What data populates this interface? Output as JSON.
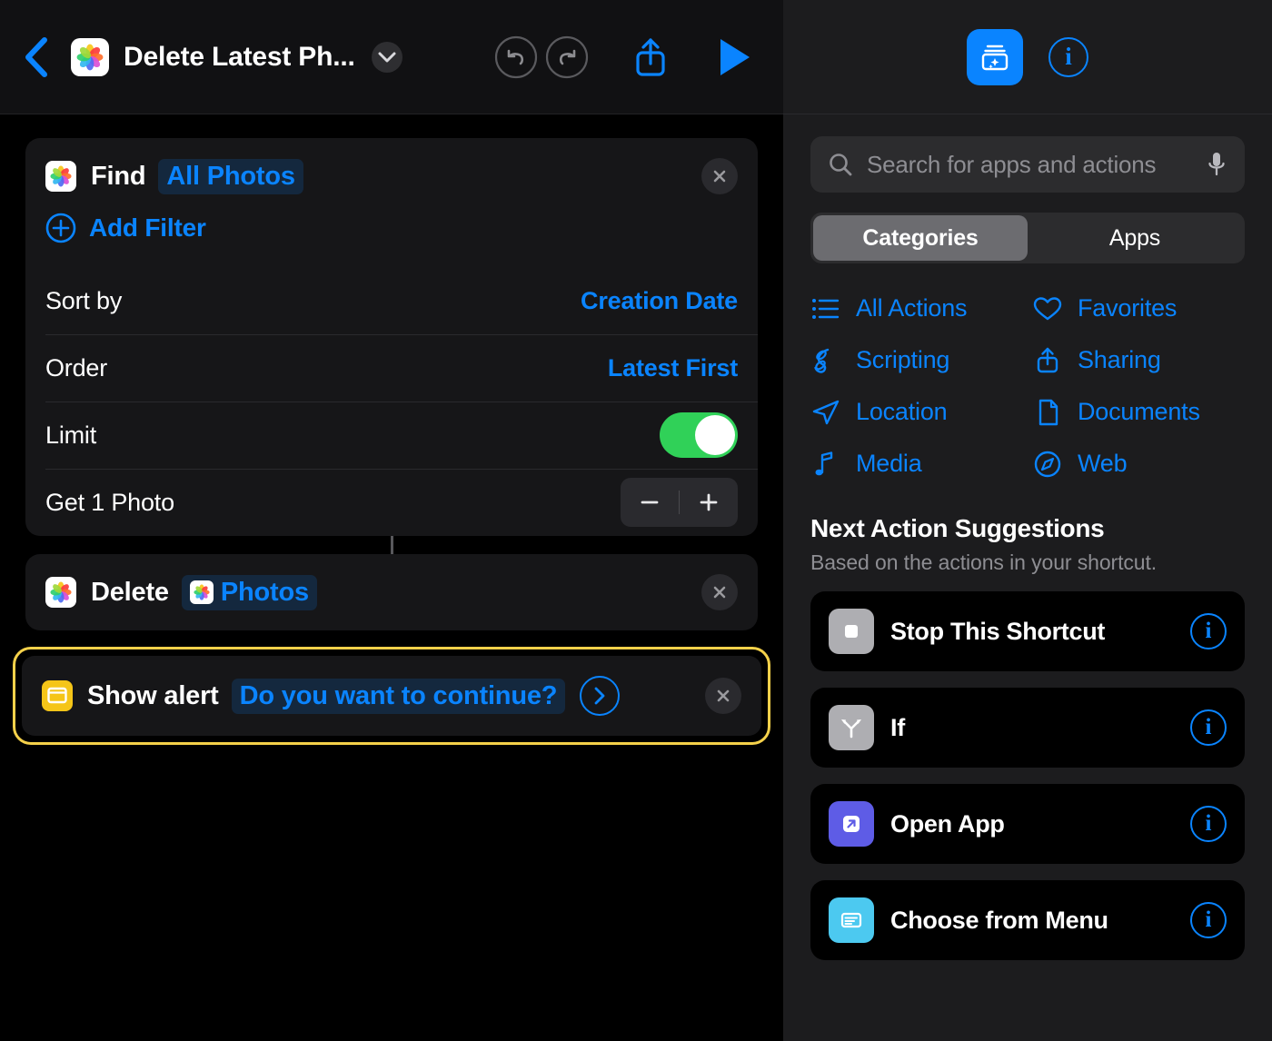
{
  "header": {
    "back_icon": "chevron-left-icon",
    "app_icon": "photos-app-icon",
    "title": "Delete Latest Ph...",
    "title_chevron_icon": "chevron-down-icon",
    "undo_icon": "undo-icon",
    "redo_icon": "redo-icon",
    "share_icon": "share-icon",
    "play_icon": "play-icon",
    "accent_color": "#0a84ff"
  },
  "shortcut": {
    "actions": [
      {
        "id": "find",
        "icon": "photos-app-icon",
        "verb": "Find",
        "token": "All Photos",
        "close_label": "×",
        "add_filter_label": "Add Filter",
        "add_filter_icon": "plus-circle-icon",
        "parameters": [
          {
            "label": "Sort by",
            "value": "Creation Date",
            "type": "value"
          },
          {
            "label": "Order",
            "value": "Latest First",
            "type": "value"
          },
          {
            "label": "Limit",
            "value": "on",
            "type": "toggle"
          },
          {
            "label": "Get 1 Photo",
            "value": "1",
            "type": "stepper",
            "minus": "−",
            "plus": "+"
          }
        ]
      },
      {
        "id": "delete",
        "icon": "photos-app-icon",
        "verb": "Delete",
        "token": "Photos",
        "token_icon": "photos-app-icon",
        "close_label": "×"
      },
      {
        "id": "show-alert",
        "icon": "alert-window-icon",
        "icon_color": "#f5c518",
        "verb": "Show alert",
        "token": "Do you want to continue?",
        "disclosure_icon": "chevron-right-circle-icon",
        "close_label": "×",
        "selected": true,
        "selection_color": "#f5d14a"
      }
    ]
  },
  "library": {
    "action_library_icon": "action-library-icon",
    "info_icon": "info-circle-icon",
    "info_label": "i",
    "search": {
      "placeholder": "Search for apps and actions",
      "search_icon": "search-icon",
      "mic_icon": "microphone-icon"
    },
    "segments": [
      {
        "label": "Categories",
        "active": true
      },
      {
        "label": "Apps",
        "active": false
      }
    ],
    "categories": [
      {
        "label": "All Actions",
        "icon": "list-bullet-icon"
      },
      {
        "label": "Favorites",
        "icon": "heart-icon"
      },
      {
        "label": "Scripting",
        "icon": "scripting-icon"
      },
      {
        "label": "Sharing",
        "icon": "share-icon"
      },
      {
        "label": "Location",
        "icon": "location-arrow-icon"
      },
      {
        "label": "Documents",
        "icon": "document-icon"
      },
      {
        "label": "Media",
        "icon": "music-note-icon"
      },
      {
        "label": "Web",
        "icon": "compass-icon"
      }
    ],
    "suggestions": {
      "title": "Next Action Suggestions",
      "subtitle": "Based on the actions in your shortcut.",
      "items": [
        {
          "label": "Stop This Shortcut",
          "icon": "stop-square-icon",
          "icon_color": "#aeaeb2",
          "info_label": "i"
        },
        {
          "label": "If",
          "icon": "branch-icon",
          "icon_color": "#aeaeb2",
          "info_label": "i"
        },
        {
          "label": "Open App",
          "icon": "open-app-icon",
          "icon_color": "#5e5ce6",
          "info_label": "i"
        },
        {
          "label": "Choose from Menu",
          "icon": "menu-list-icon",
          "icon_color": "#4cc9f0",
          "info_label": "i"
        }
      ]
    }
  }
}
